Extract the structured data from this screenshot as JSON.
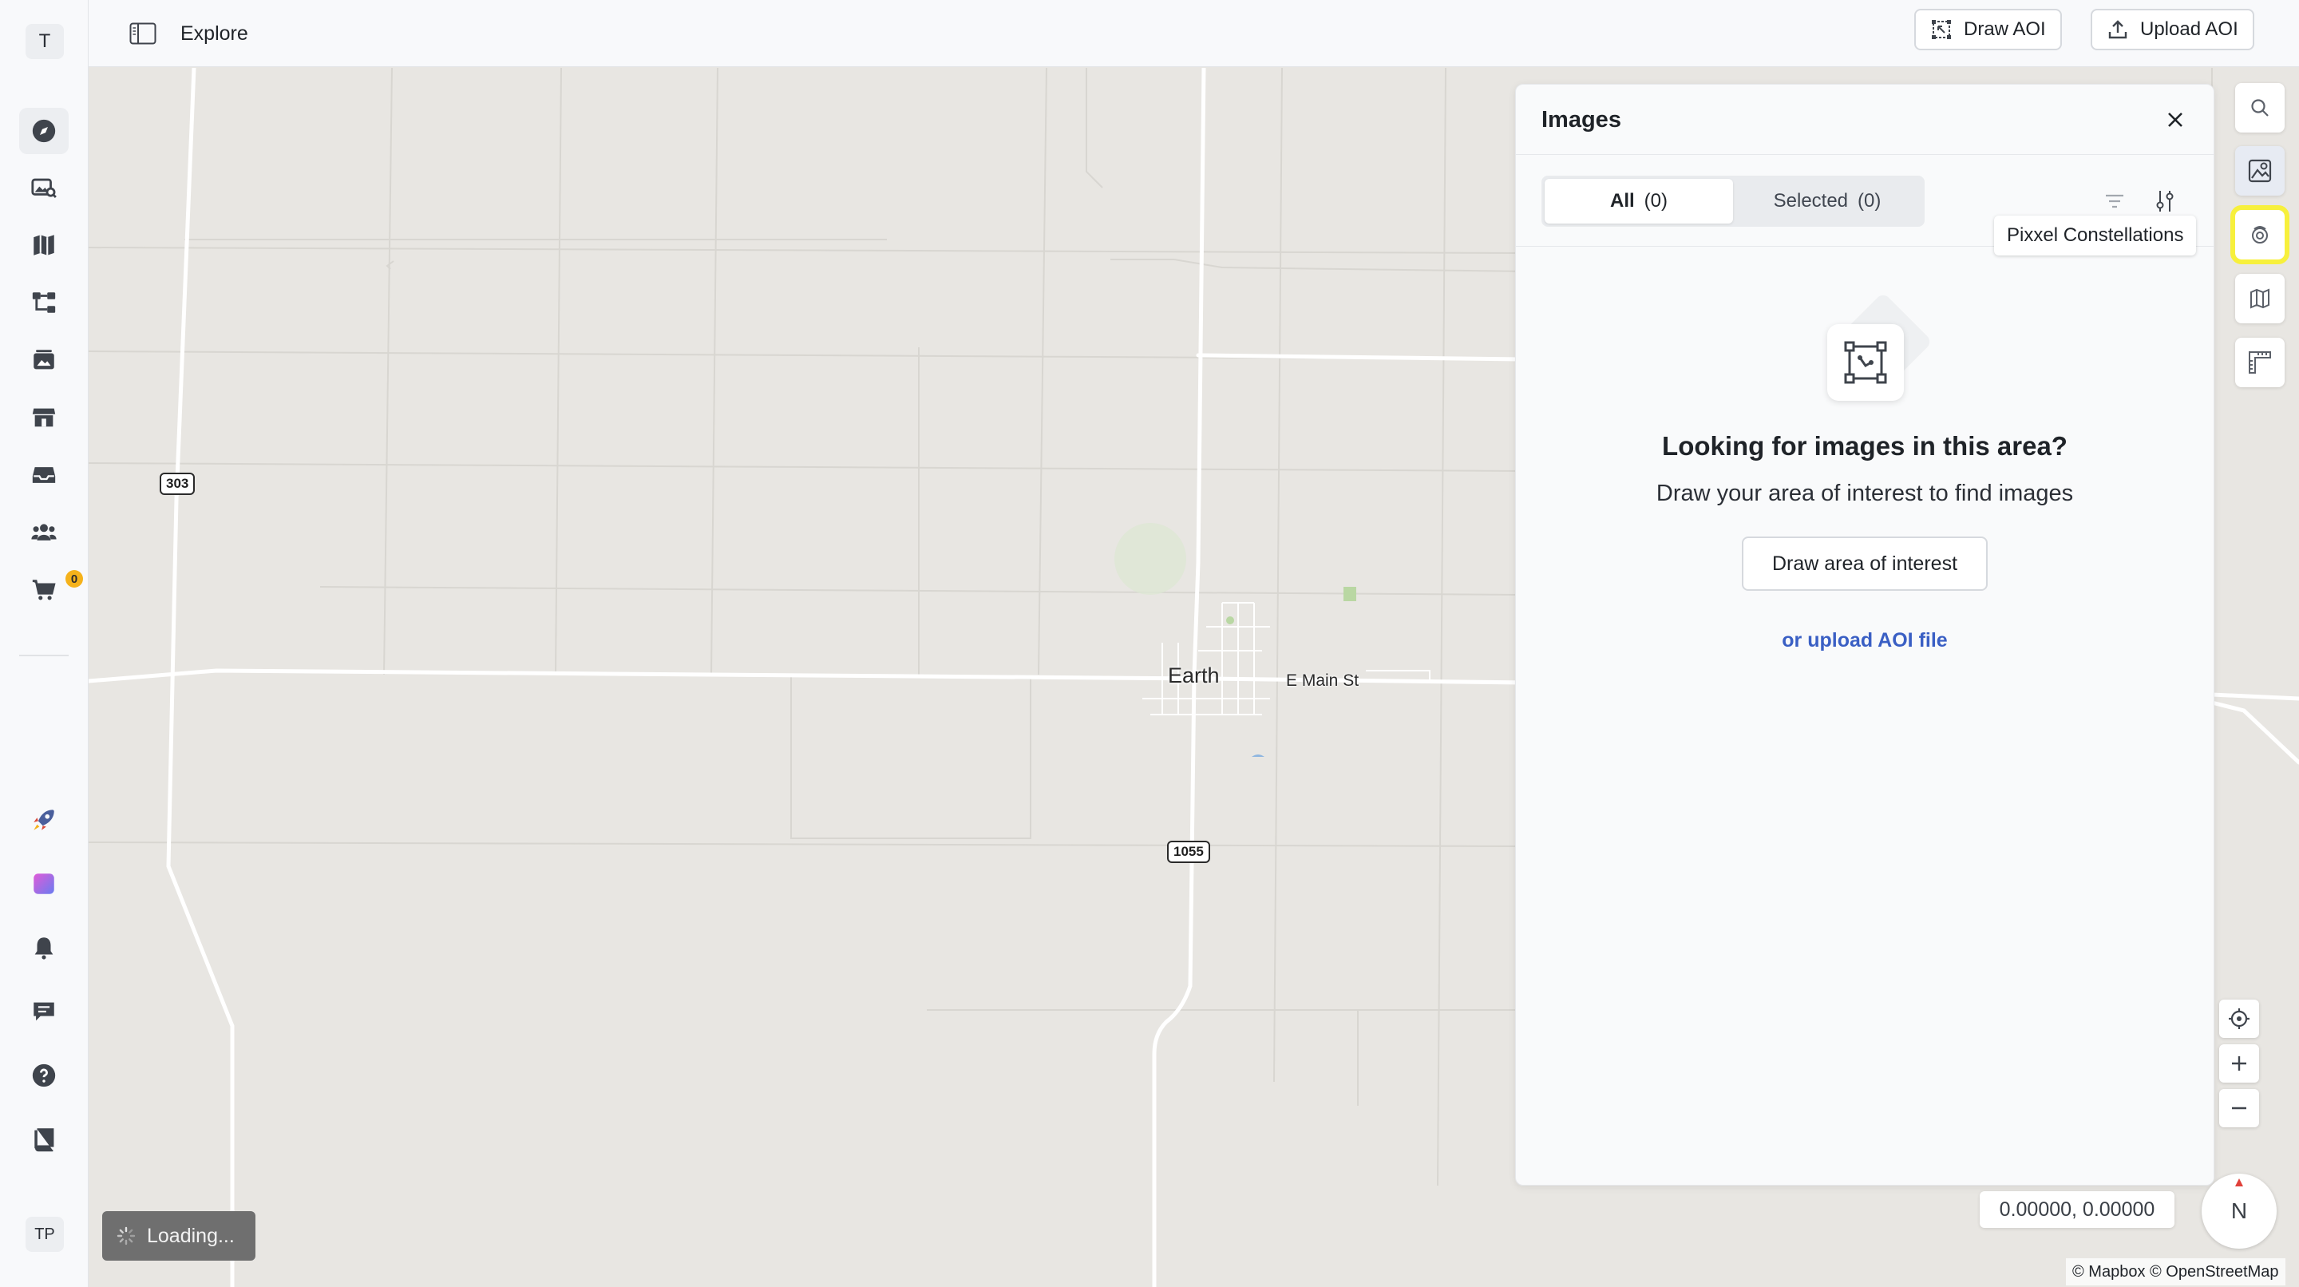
{
  "leftnav": {
    "avatar_top": "T",
    "avatar_bottom": "TP",
    "cart_count": "0",
    "items": [
      {
        "name": "explore",
        "icon": "compass-icon"
      },
      {
        "name": "imagery",
        "icon": "image-search-icon"
      },
      {
        "name": "maps",
        "icon": "map-icon"
      },
      {
        "name": "workflows",
        "icon": "workflow-icon"
      },
      {
        "name": "gallery",
        "icon": "gallery-icon"
      },
      {
        "name": "store",
        "icon": "store-icon"
      },
      {
        "name": "inbox",
        "icon": "inbox-icon"
      },
      {
        "name": "team",
        "icon": "team-icon"
      },
      {
        "name": "cart",
        "icon": "cart-icon"
      },
      {
        "name": "launch",
        "icon": "rocket-icon"
      },
      {
        "name": "apps",
        "icon": "app-tile-icon"
      },
      {
        "name": "notifications",
        "icon": "bell-icon"
      },
      {
        "name": "feedback",
        "icon": "chat-icon"
      },
      {
        "name": "help",
        "icon": "help-icon"
      },
      {
        "name": "docs",
        "icon": "book-icon"
      }
    ]
  },
  "header": {
    "title": "Explore",
    "draw_aoi_label": "Draw AOI",
    "upload_aoi_label": "Upload AOI"
  },
  "map": {
    "place": "Earth",
    "street": "E Main St",
    "shields": [
      "303",
      "1055"
    ],
    "coordinates": "0.00000, 0.00000",
    "attribution": "© Mapbox © OpenStreetMap",
    "compass_label": "N",
    "loading_text": "Loading..."
  },
  "panel": {
    "title": "Images",
    "tabs": [
      {
        "label": "All",
        "count": "(0)",
        "active": true
      },
      {
        "label": "Selected",
        "count": "(0)",
        "active": false
      }
    ],
    "empty_heading": "Looking for images in this area?",
    "empty_subtext": "Draw your area of interest to find images",
    "draw_button": "Draw area of interest",
    "upload_link": "or upload AOI file"
  },
  "right_toolbar": {
    "tooltip": "Pixxel Constellations",
    "tools": [
      "search-icon",
      "image-layers-icon",
      "constellation-icon",
      "map-layers-icon",
      "ruler-icon"
    ]
  },
  "colors": {
    "accent_link": "#3a5fc4",
    "highlight": "#f7f03c",
    "badge": "#f5b21b",
    "map_bg": "#e8e6e2"
  }
}
